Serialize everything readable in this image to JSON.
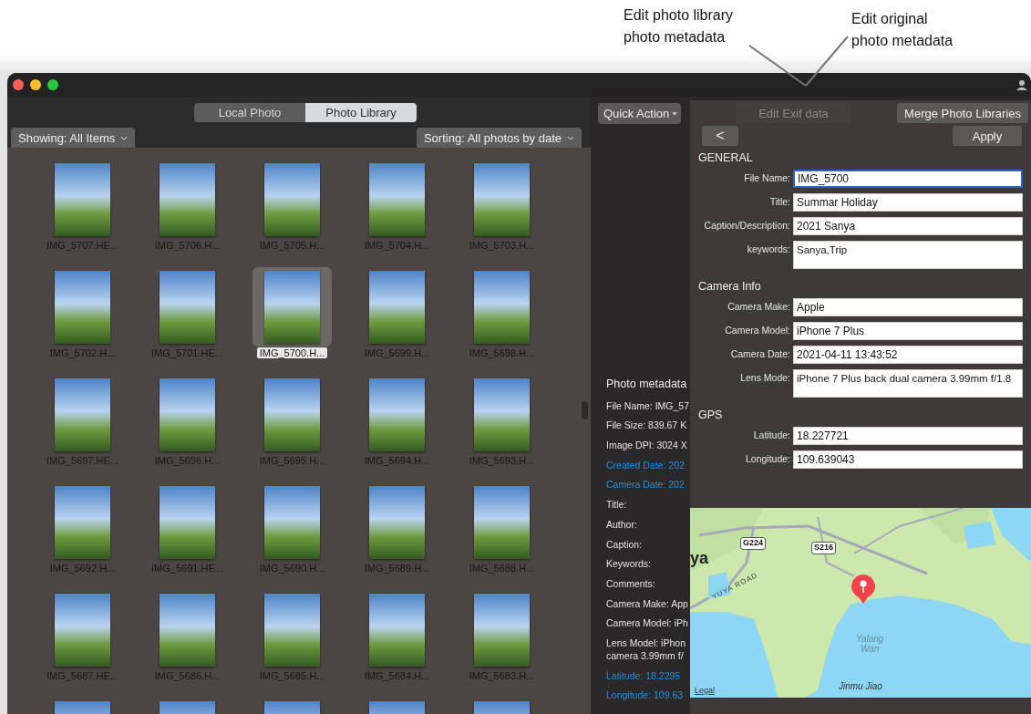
{
  "annotations": [
    {
      "text": "Edit photo library\nphoto metadata"
    },
    {
      "text": "Edit original\nphoto metadata"
    }
  ],
  "tabs": [
    {
      "label": "Local Photo",
      "selected": false
    },
    {
      "label": "Photo Library",
      "selected": true
    }
  ],
  "filter": {
    "label": "Showing: All Items"
  },
  "sorting": {
    "label": "Sorting: All photos by date"
  },
  "photos": [
    {
      "name": "IMG_5707.HE...",
      "selected": false
    },
    {
      "name": "IMG_5706.H...",
      "selected": false
    },
    {
      "name": "IMG_5705.H...",
      "selected": false
    },
    {
      "name": "IMG_5704.H...",
      "selected": false
    },
    {
      "name": "IMG_5703.H...",
      "selected": false
    },
    {
      "name": "IMG_5702.H...",
      "selected": false
    },
    {
      "name": "IMG_5701.HE...",
      "selected": false
    },
    {
      "name": "IMG_5700.H...",
      "selected": true
    },
    {
      "name": "IMG_5699.H...",
      "selected": false
    },
    {
      "name": "IMG_5698.H...",
      "selected": false
    },
    {
      "name": "IMG_5697.HE...",
      "selected": false
    },
    {
      "name": "IMG_5696.H...",
      "selected": false
    },
    {
      "name": "IMG_5695.H...",
      "selected": false
    },
    {
      "name": "IMG_5694.H...",
      "selected": false
    },
    {
      "name": "IMG_5693.H...",
      "selected": false
    },
    {
      "name": "IMG_5692.H...",
      "selected": false
    },
    {
      "name": "IMG_5691.HE...",
      "selected": false
    },
    {
      "name": "IMG_5690.H...",
      "selected": false
    },
    {
      "name": "IMG_5689.H...",
      "selected": false
    },
    {
      "name": "IMG_5688.H...",
      "selected": false
    },
    {
      "name": "IMG_5687.HE...",
      "selected": false
    },
    {
      "name": "IMG_5686.H...",
      "selected": false
    },
    {
      "name": "IMG_5685.H...",
      "selected": false
    },
    {
      "name": "IMG_5684.H...",
      "selected": false
    },
    {
      "name": "IMG_5683.H...",
      "selected": false
    },
    {
      "selected": false
    },
    {
      "selected": false
    },
    {
      "selected": false
    },
    {
      "selected": false
    },
    {
      "selected": false
    }
  ],
  "quick_action": {
    "label": "Quick Action"
  },
  "metadata": {
    "title": "Photo metadata",
    "lines": [
      {
        "text": "File Name: IMG_57",
        "highlighted": false
      },
      {
        "text": "File Size: 839.67 K",
        "highlighted": false
      },
      {
        "text": "Image DPI: 3024 X",
        "highlighted": false
      },
      {
        "text": "Created Date: 202",
        "highlighted": true
      },
      {
        "text": "Camera Date: 202",
        "highlighted": true
      },
      {
        "text": "Title:",
        "highlighted": false
      },
      {
        "text": "Author:",
        "highlighted": false
      },
      {
        "text": "Caption:",
        "highlighted": false
      },
      {
        "text": "Keywords:",
        "highlighted": false
      },
      {
        "text": "Comments:",
        "highlighted": false
      },
      {
        "text": "Camera Make: App",
        "highlighted": false
      },
      {
        "text": "Camera Model: iPh",
        "highlighted": false
      },
      {
        "text": "Lens Model: iPhon\ncamera 3.99mm f/",
        "highlighted": false
      },
      {
        "text": "Latitude: 18.2295",
        "highlighted": true
      },
      {
        "text": "Longitude: 109.63",
        "highlighted": true
      }
    ]
  },
  "editor": {
    "edit_exif": {
      "label": "Edit Exif data",
      "disabled": true
    },
    "merge": {
      "label": "Merge Photo Libraries"
    },
    "back": {
      "label": "<"
    },
    "apply": {
      "label": "Apply"
    },
    "sections": [
      {
        "title": "GENERAL",
        "fields": [
          {
            "label": "File Name:",
            "value": "IMG_5700",
            "kind": "text",
            "focused": true
          },
          {
            "label": "Title:",
            "value": "Summar Holiday",
            "kind": "text",
            "focused": false
          },
          {
            "label": "Caption/Description:",
            "value": "2021 Sanya",
            "kind": "text",
            "focused": false
          },
          {
            "label": "keywords:",
            "value": "Sanya,Trip",
            "kind": "multiline",
            "focused": false
          }
        ]
      },
      {
        "title": "Camera Info",
        "fields": [
          {
            "label": "Camera Make:",
            "value": "Apple",
            "kind": "text",
            "focused": false
          },
          {
            "label": "Camera Model:",
            "value": "iPhone 7 Plus",
            "kind": "text",
            "focused": false
          },
          {
            "label": "Camera Date:",
            "value": "2021-04-11 13:43:52",
            "kind": "text",
            "focused": false
          },
          {
            "label": "Lens Mode:",
            "value": "iPhone 7 Plus back dual camera 3.99mm f/1.8",
            "kind": "multiline",
            "focused": false
          }
        ]
      },
      {
        "title": "GPS",
        "fields": [
          {
            "label": "Latitude:",
            "value": "18.227721",
            "kind": "text",
            "focused": false
          },
          {
            "label": "Longitude:",
            "value": "109.639043",
            "kind": "text",
            "focused": false
          }
        ]
      }
    ],
    "map": {
      "labels": [
        {
          "text": "ya",
          "kind": "place"
        },
        {
          "text": "G224",
          "kind": "shield"
        },
        {
          "text": "S216",
          "kind": "shield"
        },
        {
          "text": "YUYA ROAD",
          "kind": "road"
        },
        {
          "text": "Yalang\nWan",
          "kind": "water"
        },
        {
          "text": "Jinmu Jiao",
          "kind": "cape"
        }
      ],
      "legal": "Legal"
    }
  }
}
